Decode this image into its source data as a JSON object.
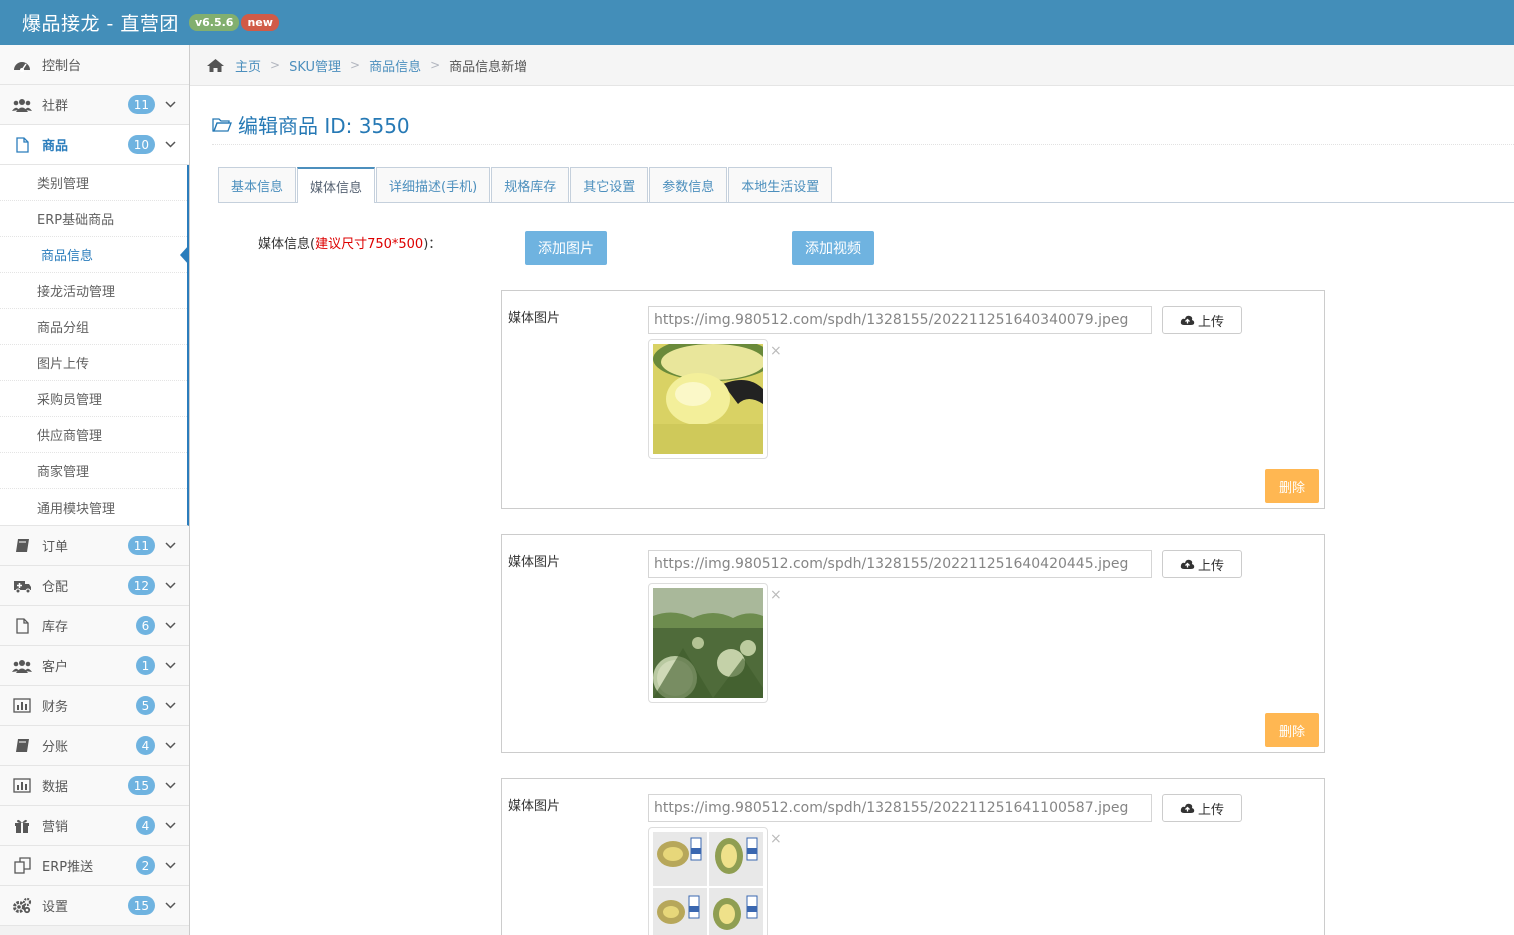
{
  "app": {
    "title": "爆品接龙 - 直营团",
    "version": "v6.5.6",
    "new_badge": "new"
  },
  "sidebar": {
    "items": [
      {
        "label": "控制台",
        "icon": "dashboard-icon"
      },
      {
        "label": "社群",
        "count": "11",
        "icon": "users-icon"
      },
      {
        "label": "商品",
        "count": "10",
        "icon": "file-icon",
        "children": [
          "类别管理",
          "ERP基础商品",
          "商品信息",
          "接龙活动管理",
          "商品分组",
          "图片上传",
          "采购员管理",
          "供应商管理",
          "商家管理",
          "通用模块管理"
        ]
      },
      {
        "label": "订单",
        "count": "11",
        "icon": "book-icon"
      },
      {
        "label": "仓配",
        "count": "12",
        "icon": "ambulance-icon"
      },
      {
        "label": "库存",
        "count": "6",
        "icon": "file-icon"
      },
      {
        "label": "客户",
        "count": "1",
        "icon": "users-icon"
      },
      {
        "label": "财务",
        "count": "5",
        "icon": "bar-chart-icon"
      },
      {
        "label": "分账",
        "count": "4",
        "icon": "book-icon"
      },
      {
        "label": "数据",
        "count": "15",
        "icon": "bar-chart-icon"
      },
      {
        "label": "营销",
        "count": "4",
        "icon": "gift-icon"
      },
      {
        "label": "ERP推送",
        "count": "2",
        "icon": "copy-icon"
      },
      {
        "label": "设置",
        "count": "15",
        "icon": "cogs-icon"
      }
    ]
  },
  "breadcrumb": {
    "home": "主页",
    "sku": "SKU管理",
    "info": "商品信息",
    "current": "商品信息新增"
  },
  "page": {
    "title": "编辑商品 ID: 3550"
  },
  "tabs": [
    "基本信息",
    "媒体信息",
    "详细描述(手机)",
    "规格库存",
    "其它设置",
    "参数信息",
    "本地生活设置"
  ],
  "media": {
    "label": "媒体信息(",
    "hint": "建议尺寸750*500",
    "label_end": ")：",
    "add_image": "添加图片",
    "add_video": "添加视频",
    "card_label": "媒体图片",
    "upload_label": "上传",
    "delete_label": "删除",
    "close_glyph": "×",
    "items": [
      {
        "url": "https://img.980512.com/spdh/1328155/202211251640340079.jpeg"
      },
      {
        "url": "https://img.980512.com/spdh/1328155/202211251640420445.jpeg"
      },
      {
        "url": "https://img.980512.com/spdh/1328155/202211251641100587.jpeg"
      }
    ]
  },
  "colors": {
    "topbar": "#438eb9",
    "accent": "#2b7dbc",
    "badge": "#6fb3e0",
    "warning": "#ffb752"
  }
}
